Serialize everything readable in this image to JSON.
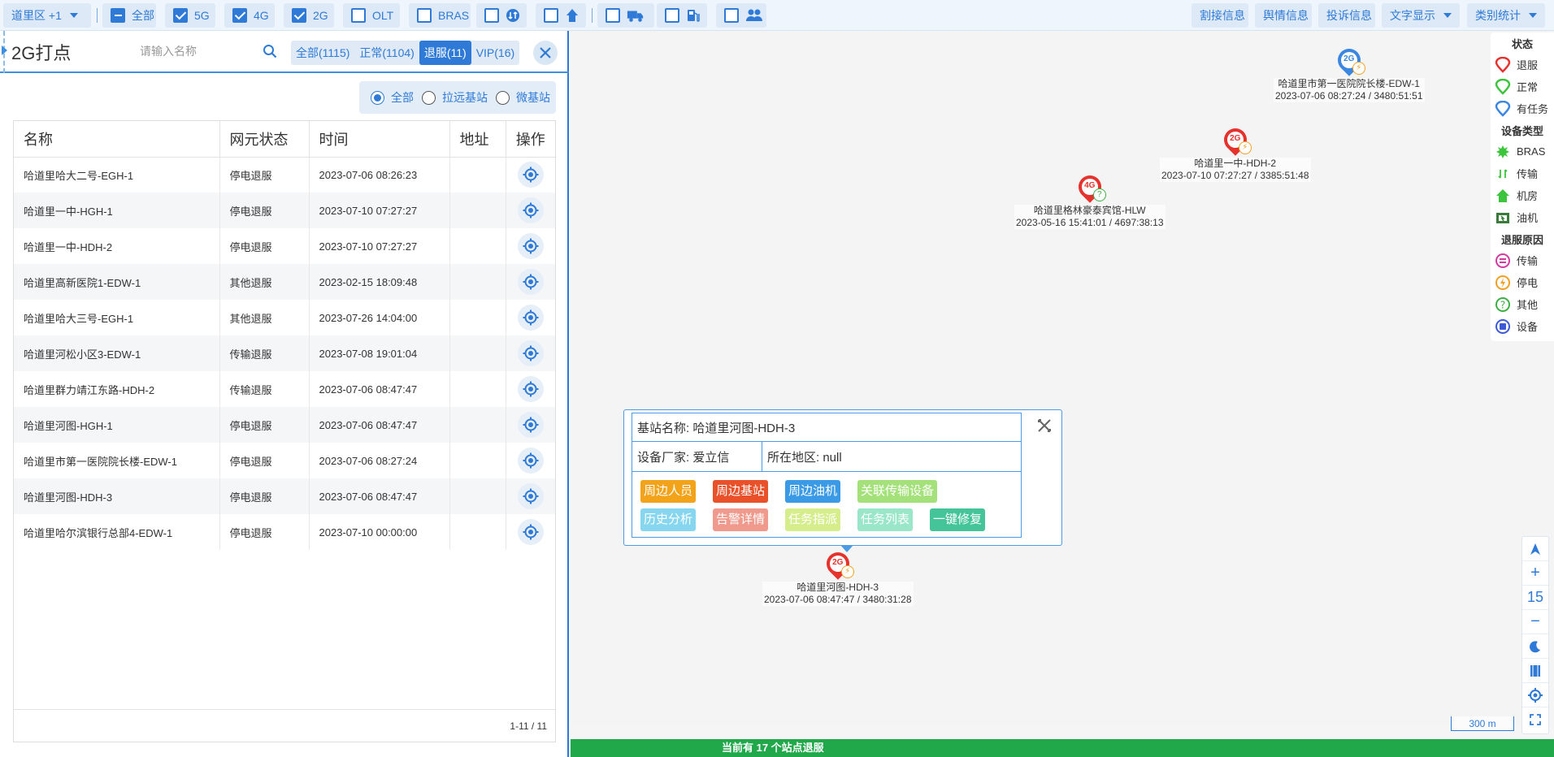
{
  "toolbar": {
    "region": "道里区 +1",
    "filters": [
      {
        "label": "全部",
        "state": "minus"
      },
      {
        "label": "5G",
        "state": "checked"
      },
      {
        "label": "4G",
        "state": "checked"
      },
      {
        "label": "2G",
        "state": "checked"
      },
      {
        "label": "OLT",
        "state": "unchecked"
      },
      {
        "label": "BRAS",
        "state": "unchecked"
      }
    ],
    "icon_filters": [
      "transmission-icon",
      "room-icon",
      "truck-icon",
      "fuel-icon",
      "people-icon"
    ],
    "right_buttons": [
      "割接信息",
      "舆情信息",
      "投诉信息"
    ],
    "dropdowns": [
      "文字显示",
      "类别统计"
    ]
  },
  "panel": {
    "title": "2G打点",
    "search_placeholder": "请输入名称",
    "tabs": [
      {
        "label": "全部(1115)",
        "active": false
      },
      {
        "label": "正常(1104)",
        "active": false
      },
      {
        "label": "退服(11)",
        "active": true
      },
      {
        "label": "VIP(16)",
        "active": false
      }
    ],
    "radios": [
      {
        "label": "全部",
        "on": true
      },
      {
        "label": "拉远基站",
        "on": false
      },
      {
        "label": "微基站",
        "on": false
      }
    ]
  },
  "table": {
    "columns": [
      "名称",
      "网元状态",
      "时间",
      "地址",
      "操作"
    ],
    "rows": [
      {
        "name": "哈道里哈大二号-EGH-1",
        "status": "停电退服",
        "time": "2023-07-06 08:26:23",
        "address": ""
      },
      {
        "name": "哈道里一中-HGH-1",
        "status": "停电退服",
        "time": "2023-07-10 07:27:27",
        "address": ""
      },
      {
        "name": "哈道里一中-HDH-2",
        "status": "停电退服",
        "time": "2023-07-10 07:27:27",
        "address": ""
      },
      {
        "name": "哈道里高新医院1-EDW-1",
        "status": "其他退服",
        "time": "2023-02-15 18:09:48",
        "address": ""
      },
      {
        "name": "哈道里哈大三号-EGH-1",
        "status": "其他退服",
        "time": "2023-07-26 14:04:00",
        "address": ""
      },
      {
        "name": "哈道里河松小区3-EDW-1",
        "status": "传输退服",
        "time": "2023-07-08 19:01:04",
        "address": ""
      },
      {
        "name": "哈道里群力靖江东路-HDH-2",
        "status": "传输退服",
        "time": "2023-07-06 08:47:47",
        "address": ""
      },
      {
        "name": "哈道里河图-HGH-1",
        "status": "停电退服",
        "time": "2023-07-06 08:47:47",
        "address": ""
      },
      {
        "name": "哈道里市第一医院院长楼-EDW-1",
        "status": "停电退服",
        "time": "2023-07-06 08:27:24",
        "address": ""
      },
      {
        "name": "哈道里河图-HDH-3",
        "status": "停电退服",
        "time": "2023-07-06 08:47:47",
        "address": ""
      },
      {
        "name": "哈道里哈尔滨银行总部4-EDW-1",
        "status": "停电退服",
        "time": "2023-07-10 00:00:00",
        "address": ""
      }
    ],
    "pagination": "1-11 / 11"
  },
  "map": {
    "markers": [
      {
        "type": "2G",
        "color": "#3a86e0",
        "badge": "power",
        "name": "哈道里市第一医院院长楼-EDW-1",
        "info": "2023-07-06 08:27:24 / 3480:51:51"
      },
      {
        "type": "2G",
        "color": "#e5322d",
        "badge": "power",
        "name": "哈道里一中-HDH-2",
        "info": "2023-07-10 07:27:27 / 3385:51:48"
      },
      {
        "type": "4G",
        "color": "#e5322d",
        "badge": "other",
        "name": "哈道里格林豪泰宾馆-HLW",
        "info": "2023-05-16 15:41:01 / 4697:38:13"
      },
      {
        "type": "2G",
        "color": "#e5322d",
        "badge": "power",
        "name": "哈道里河图-HDH-3",
        "info": "2023-07-06 08:47:47 / 3480:31:28"
      }
    ],
    "zoom_level": "15",
    "scale": "300 m",
    "status_text": "当前有 17 个站点退服"
  },
  "legend": {
    "sections": [
      {
        "title": "状态",
        "items": [
          {
            "label": "退服",
            "icon": "pin-red-icon",
            "color": "#e5322d"
          },
          {
            "label": "正常",
            "icon": "pin-green-icon",
            "color": "#3cc43c"
          },
          {
            "label": "有任务",
            "icon": "pin-blue-icon",
            "color": "#3a86e0"
          }
        ]
      },
      {
        "title": "设备类型",
        "items": [
          {
            "label": "BRAS",
            "icon": "bras-icon",
            "color": "#3cc43c"
          },
          {
            "label": "传输",
            "icon": "transmission-icon",
            "color": "#3cc43c"
          },
          {
            "label": "机房",
            "icon": "room-icon",
            "color": "#3cc43c"
          },
          {
            "label": "油机",
            "icon": "generator-icon",
            "color": "#3a7a3a"
          }
        ]
      },
      {
        "title": "退服原因",
        "items": [
          {
            "label": "传输",
            "icon": "transmission-cause-icon",
            "color": "#d63aa0"
          },
          {
            "label": "停电",
            "icon": "power-cause-icon",
            "color": "#f0a020"
          },
          {
            "label": "其他",
            "icon": "other-cause-icon",
            "color": "#3cb043"
          },
          {
            "label": "设备",
            "icon": "device-cause-icon",
            "color": "#3a5ad6"
          }
        ]
      }
    ]
  },
  "popup": {
    "station_label": "基站名称: 哈道里河图-HDH-3",
    "vendor_label": "设备厂家: 爱立信",
    "region_label": "所在地区: null",
    "buttons": [
      {
        "label": "周边人员",
        "color": "#f2a31a"
      },
      {
        "label": "周边基站",
        "color": "#e8512a"
      },
      {
        "label": "周边油机",
        "color": "#3a9ae6"
      },
      {
        "label": "关联传输设备",
        "color": "#a4e17a"
      },
      {
        "label": "历史分析",
        "color": "#86d6ef"
      },
      {
        "label": "告警详情",
        "color": "#ef9a8c"
      },
      {
        "label": "任务指派",
        "color": "#d6ed8c"
      },
      {
        "label": "任务列表",
        "color": "#9ae6c8"
      },
      {
        "label": "一键修复",
        "color": "#45c49a"
      }
    ]
  }
}
